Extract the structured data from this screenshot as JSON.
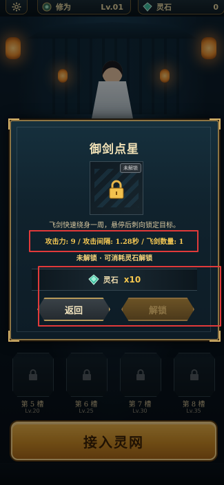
{
  "topbar": {
    "cultivation_label": "修为",
    "cultivation_value": "Lv.01",
    "stone_label": "灵石",
    "stone_value": "0"
  },
  "dialog": {
    "title": "御剑点星",
    "badge": "未解锁",
    "description": "飞剑快速绕身一周，悬停后刺向锁定目标。",
    "stats": "攻击力: 9 / 攻击间隔: 1.28秒 / 飞剑数量: 1",
    "unlock_hint": "未解锁 · 可消耗灵石解锁",
    "cost_label": "灵石",
    "cost_qty": "x10",
    "back_label": "返回",
    "unlock_label": "解锁"
  },
  "slots": [
    {
      "title": "第 5 槽",
      "level": "Lv.20"
    },
    {
      "title": "第 6 槽",
      "level": "Lv.25"
    },
    {
      "title": "第 7 槽",
      "level": "Lv.30"
    },
    {
      "title": "第 8 槽",
      "level": "Lv.35"
    }
  ],
  "connect_button": "接入灵网",
  "colors": {
    "accent_gold": "#e9b24a",
    "stats_text": "#f0c452",
    "annotation_red": "#e23a3a"
  }
}
